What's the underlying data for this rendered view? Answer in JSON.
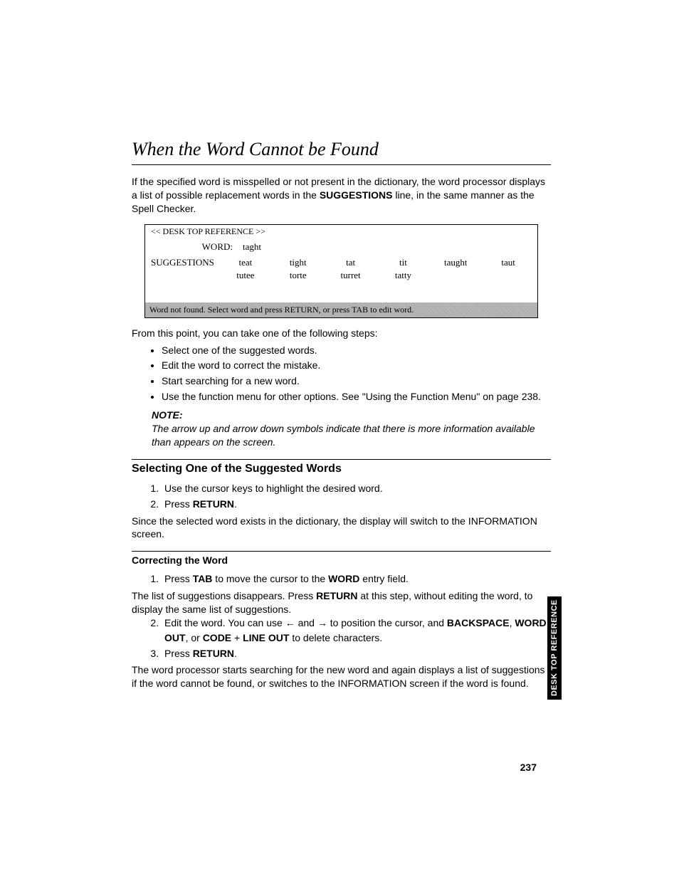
{
  "title": "When the Word Cannot be Found",
  "intro": {
    "p1a": "If the specified word is misspelled or not present in the dictionary, the word processor displays a list of possible replacement words in the ",
    "p1b": "SUGGESTIONS",
    "p1c": " line, in the same manner as the Spell Checker."
  },
  "screenshot": {
    "title": "<< DESK TOP REFERENCE >>",
    "word_label": "WORD:",
    "word_value": "taght",
    "suggestions_label": "SUGGESTIONS",
    "suggestions": [
      "teat",
      "tight",
      "tat",
      "tit",
      "taught",
      "taut",
      "tutee",
      "torte",
      "turret",
      "tatty"
    ],
    "status": "Word not found.  Select word and press RETURN, or press TAB to edit word."
  },
  "after_screenshot": "From this point, you can take one of the following steps:",
  "bullets": [
    "Select one of the suggested words.",
    "Edit the word to correct the mistake.",
    "Start searching for a new word.",
    "Use the function menu for other options. See \"Using the Function Menu\" on page 238."
  ],
  "note": {
    "label": "NOTE:",
    "text": "The arrow up and arrow down symbols indicate that there is more information available than appears on the screen."
  },
  "section1": {
    "heading": "Selecting One of the Suggested Words",
    "step1": "Use the cursor keys to highlight the desired word.",
    "step2a": "Press ",
    "step2b": "RETURN",
    "step2c": ".",
    "after": "Since the selected word exists in the dictionary, the display will switch to the INFORMATION screen."
  },
  "section2": {
    "heading": "Correcting the Word",
    "step1": {
      "a": "Press ",
      "b": "TAB",
      "c": " to move the cursor to the ",
      "d": "WORD",
      "e": " entry field."
    },
    "aftermid1": {
      "a": "The list of suggestions disappears. Press ",
      "b": "RETURN",
      "c": " at this step, without editing the word, to display the same list of suggestions."
    },
    "step2": {
      "a": "Edit the word. You can use ← and → to position the cursor, and ",
      "b": "BACKSPACE",
      "c": ", ",
      "d": "WORD OUT",
      "e": ", or ",
      "f": "CODE",
      "g": " + ",
      "h": "LINE OUT",
      "i": " to delete characters."
    },
    "step3": {
      "a": "Press ",
      "b": "RETURN",
      "c": "."
    },
    "after": "The word processor starts searching for the new word and again displays a list of suggestions if the word cannot be found, or switches to the INFORMATION screen if the word is found."
  },
  "page_number": "237",
  "side_tab": "DESK TOP REFERENCE"
}
